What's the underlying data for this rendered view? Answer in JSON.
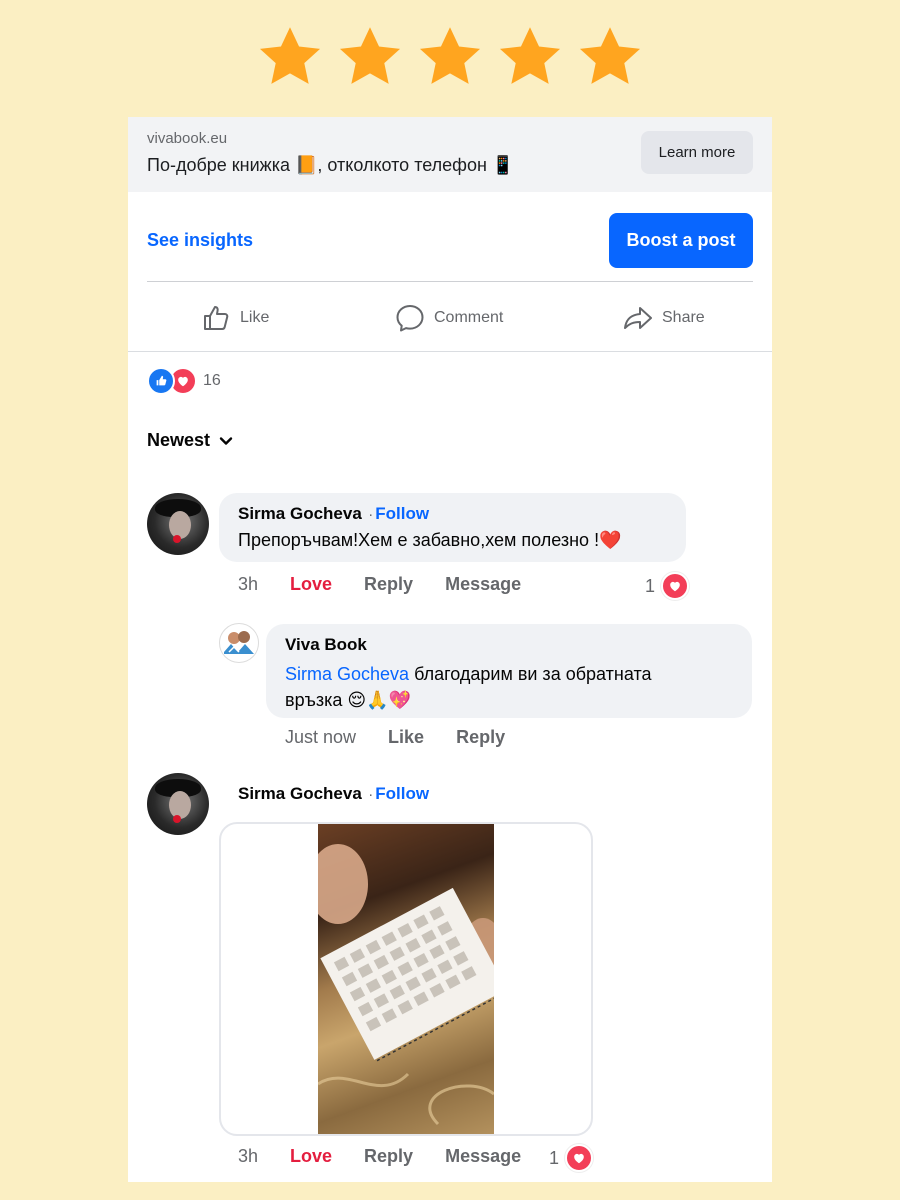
{
  "rating": {
    "stars": 5,
    "star_color": "#ffa51f"
  },
  "ad": {
    "domain": "vivabook.eu",
    "headline": "По-добре книжка 📙, отколкото телефон 📱",
    "learn_more": "Learn more"
  },
  "insights": {
    "link": "See insights",
    "boost": "Boost a post"
  },
  "actions": {
    "like": "Like",
    "comment": "Comment",
    "share": "Share"
  },
  "reactions": {
    "count": "16"
  },
  "sort": {
    "label": "Newest"
  },
  "comments": [
    {
      "author": "Sirma Gocheva",
      "follow": "Follow",
      "text": "Препоръчвам!Хем е забавно,хем полезно !❤️",
      "time": "3h",
      "love": "Love",
      "reply": "Reply",
      "message": "Message",
      "reaction_count": "1"
    },
    {
      "author": "Viva Book",
      "mention": "Sirma Gocheva",
      "text": " благодарим ви за обратната връзка 😌🙏💖",
      "time": "Just now",
      "like": "Like",
      "reply": "Reply"
    },
    {
      "author": "Sirma Gocheva",
      "follow": "Follow",
      "media": "video-thumbnail",
      "time": "3h",
      "love": "Love",
      "reply": "Reply",
      "message": "Message",
      "reaction_count": "1"
    }
  ],
  "colors": {
    "background": "#fbefc3",
    "accent": "#0866ff",
    "love": "#e41e3f"
  }
}
